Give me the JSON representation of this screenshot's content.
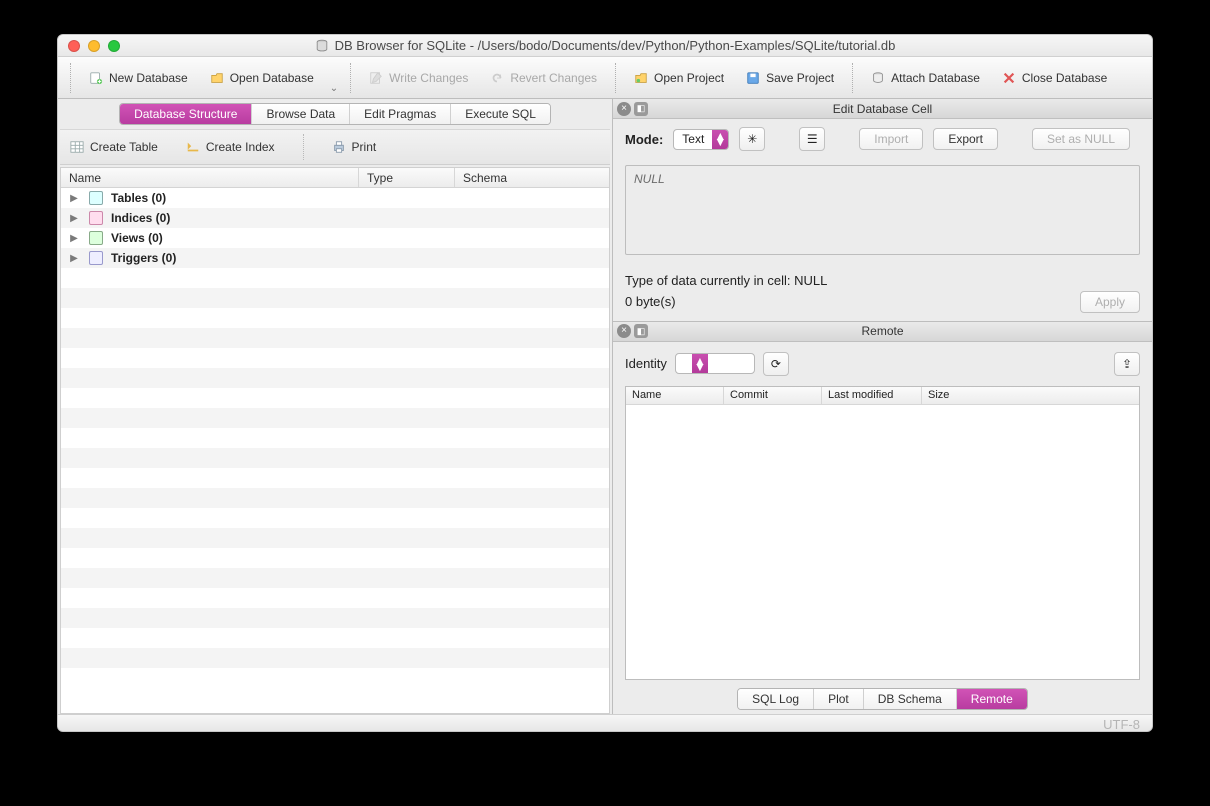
{
  "window": {
    "title": "DB Browser for SQLite - /Users/bodo/Documents/dev/Python/Python-Examples/SQLite/tutorial.db"
  },
  "toolbar": {
    "new_db": "New Database",
    "open_db": "Open Database",
    "write": "Write Changes",
    "revert": "Revert Changes",
    "open_proj": "Open Project",
    "save_proj": "Save Project",
    "attach": "Attach Database",
    "close": "Close Database"
  },
  "tabs": [
    "Database Structure",
    "Browse Data",
    "Edit Pragmas",
    "Execute SQL"
  ],
  "structure_toolbar": {
    "create_table": "Create Table",
    "create_index": "Create Index",
    "print": "Print"
  },
  "tree_cols": [
    "Name",
    "Type",
    "Schema"
  ],
  "tree": [
    "Tables (0)",
    "Indices (0)",
    "Views (0)",
    "Triggers (0)"
  ],
  "edit_cell": {
    "title": "Edit Database Cell",
    "mode_label": "Mode:",
    "mode_value": "Text",
    "import": "Import",
    "export": "Export",
    "set_null": "Set as NULL",
    "content": "NULL",
    "type_text": "Type of data currently in cell: NULL",
    "size_text": "0 byte(s)",
    "apply": "Apply"
  },
  "remote": {
    "title": "Remote",
    "identity_label": "Identity",
    "identity_value": " ",
    "cols": [
      "Name",
      "Commit",
      "Last modified",
      "Size"
    ]
  },
  "bottom_tabs": [
    "SQL Log",
    "Plot",
    "DB Schema",
    "Remote"
  ],
  "status": {
    "encoding": "UTF-8"
  }
}
